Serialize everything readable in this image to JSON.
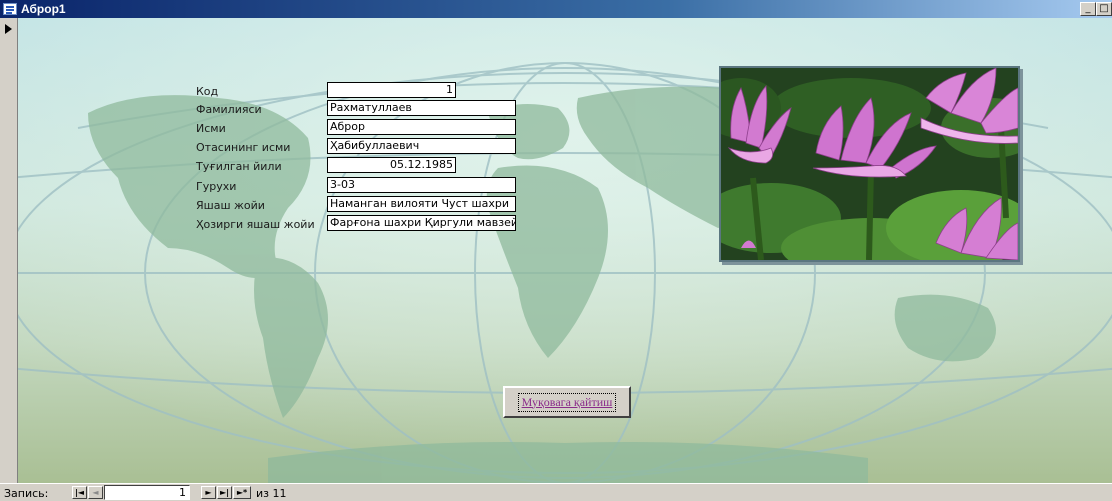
{
  "window": {
    "title": "Аброр1",
    "minimize_glyph": "_",
    "maximize_glyph": "□"
  },
  "form": {
    "fields": [
      {
        "label": "Код",
        "value": "1"
      },
      {
        "label": "Фамилияси",
        "value": "Рахматуллаев"
      },
      {
        "label": "Исми",
        "value": "Аброр"
      },
      {
        "label": "Отасининг исми",
        "value": "Ҳабибуллаевич"
      },
      {
        "label": "Туғилган йили",
        "value": "05.12.1985"
      },
      {
        "label": "Гурухи",
        "value": "3-03"
      },
      {
        "label": "Яшаш жойи",
        "value": "Наманган вилояти Чуст шахри"
      },
      {
        "label": "Ҳозирги яшаш жойи",
        "value": "Фарғона шахри Қиргули мавзейи"
      }
    ],
    "photo_subject": "pink water lilies",
    "back_button_label": "Муқовага қайтиш"
  },
  "navigation": {
    "record_label": "Запись:",
    "current_record": "1",
    "of_text": "из  11",
    "first_glyph": "|◄",
    "prev_glyph": "◄",
    "next_glyph": "►",
    "last_glyph": "►|",
    "new_glyph": "►*"
  },
  "colors": {
    "titlebar_start": "#0a246a",
    "titlebar_end": "#a6caf0",
    "button_text": "#8a2a8a"
  }
}
